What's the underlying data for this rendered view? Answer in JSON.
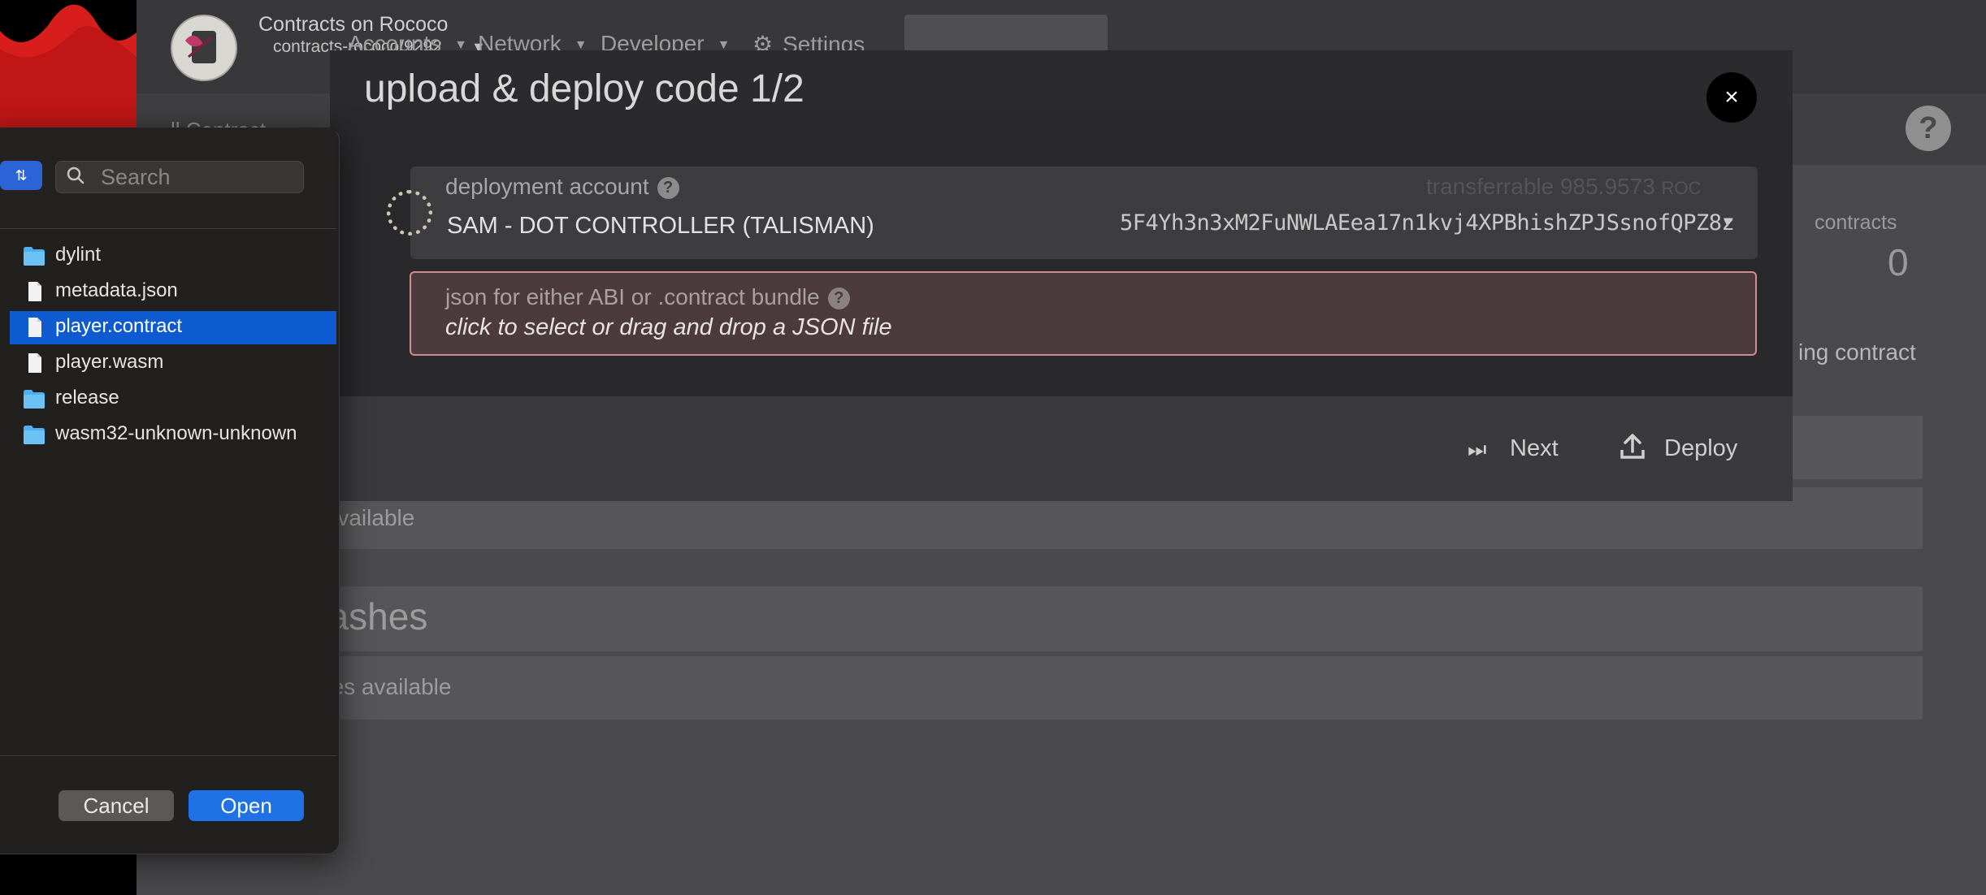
{
  "app": {
    "chain_name": "Contracts on Rococo",
    "chain_url": "contracts-rococo/9292",
    "nav": {
      "accounts": "Accounts",
      "network": "Network",
      "developer": "Developer",
      "settings": "Settings"
    },
    "sidebar_partial": "ll Contract",
    "stats": {
      "contracts_label": "contracts",
      "contracts_value": "0"
    },
    "partial_button": "ing contract",
    "contracts_empty": "s available",
    "code_hashes_title": "hashes",
    "code_hashes_empty": "shes available"
  },
  "modal": {
    "title": "upload & deploy code 1/2",
    "close_label": "×",
    "account": {
      "label": "deployment account",
      "transferrable_label": "transferrable",
      "transferrable_value": "985.9573",
      "transferrable_unit": "ROC",
      "name": "SAM - DOT CONTROLLER (TALISMAN)",
      "address": "5F4Yh3n3xM2FuNWLAEea17n1kvj4XPBhishZPJSsnofQPZ8z"
    },
    "json": {
      "label": "json for either ABI or .contract bundle",
      "hint": "click to select or drag and drop a JSON file"
    },
    "buttons": {
      "next": "Next",
      "deploy": "Deploy"
    }
  },
  "file_dialog": {
    "search_placeholder": "Search",
    "files": [
      {
        "name": "dylint",
        "kind": "folder",
        "selected": false
      },
      {
        "name": "metadata.json",
        "kind": "file",
        "selected": false
      },
      {
        "name": "player.contract",
        "kind": "file",
        "selected": true
      },
      {
        "name": "player.wasm",
        "kind": "file",
        "selected": false
      },
      {
        "name": "release",
        "kind": "folder",
        "selected": false
      },
      {
        "name": "wasm32-unknown-unknown",
        "kind": "folder",
        "selected": false
      }
    ],
    "cancel_label": "Cancel",
    "open_label": "Open"
  },
  "colors": {
    "accent": "#1f72e6",
    "selection": "#0e5bd1",
    "error_border": "#d28e8e",
    "modal_bg": "#2b2b2d"
  }
}
